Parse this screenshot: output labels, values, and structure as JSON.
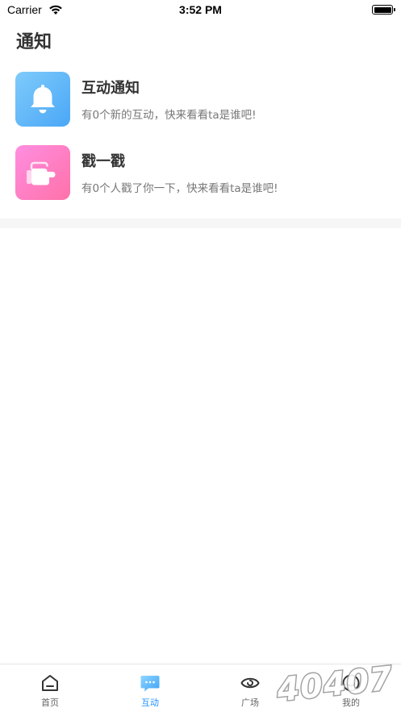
{
  "status_bar": {
    "carrier": "Carrier",
    "time": "3:52 PM",
    "battery_level": 1.0,
    "icons": [
      "wifi-icon",
      "battery-icon"
    ]
  },
  "page": {
    "title": "通知"
  },
  "notices": [
    {
      "title": "互动通知",
      "subtitle": "有0个新的互动，快来看看ta是谁吧!",
      "icon": "bell-icon",
      "icon_colors": [
        "#7fcbfb",
        "#4aa7f6"
      ]
    },
    {
      "title": "戳一戳",
      "subtitle": "有0个人戳了你一下，快来看看ta是谁吧!",
      "icon": "poke-hand-icon",
      "icon_colors": [
        "#ff8ee0",
        "#ff71a9"
      ]
    }
  ],
  "tab_bar": {
    "active_index": 1,
    "active_color": "#1e90ff",
    "tabs": [
      {
        "label": "首页",
        "icon": "home-icon"
      },
      {
        "label": "互动",
        "icon": "chat-bubble-icon"
      },
      {
        "label": "广场",
        "icon": "eye-icon"
      },
      {
        "label": "我的",
        "icon": "profile-icon"
      }
    ]
  },
  "watermark": {
    "text": "40407"
  }
}
